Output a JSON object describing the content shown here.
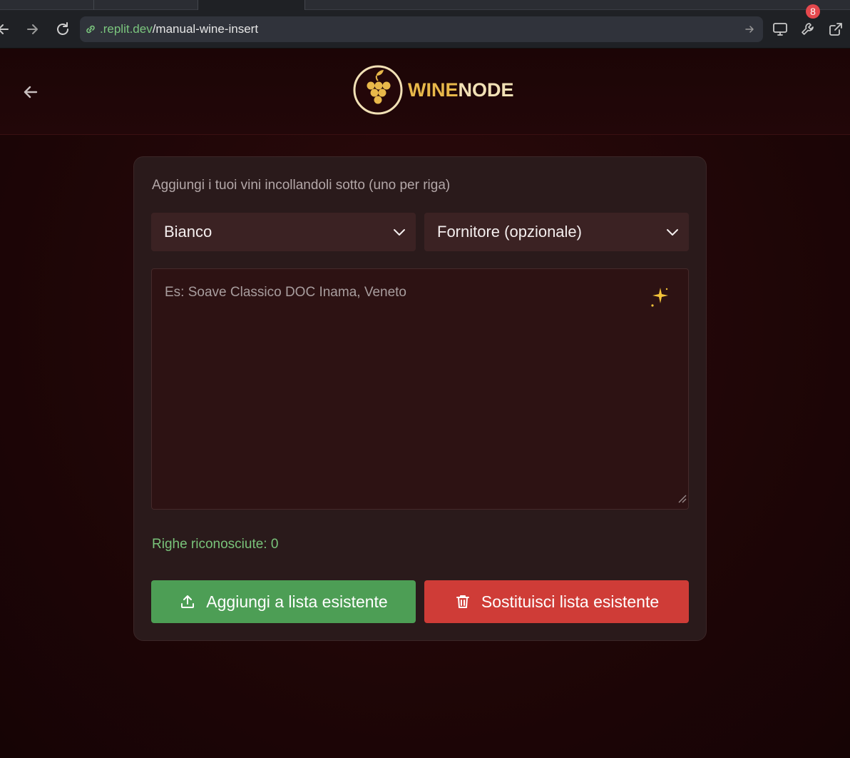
{
  "browser": {
    "url_host": ".replit.dev",
    "url_path": "/manual-wine-insert",
    "extensions_badge": "8",
    "icons": [
      "back-icon",
      "forward-icon",
      "reload-icon",
      "link-icon",
      "go-arrow-icon",
      "screen-icon",
      "wrench-icon",
      "external-link-icon"
    ]
  },
  "header": {
    "logo_wine": "WINE",
    "logo_node": "NODE",
    "back_icon": "arrow-left-icon"
  },
  "form": {
    "instruction": "Aggiungi i tuoi vini incollandoli sotto (uno per riga)",
    "type_select": "Bianco",
    "supplier_select": "Fornitore (opzionale)",
    "textarea_placeholder": "Es: Soave Classico DOC Inama, Veneto",
    "recognized_rows": "Righe riconosciute: 0",
    "add_button": "Aggiungi a lista esistente",
    "replace_button": "Sostituisci lista esistente"
  },
  "colors": {
    "accent_green": "#4d9e55",
    "accent_red": "#cf3c37",
    "logo_gold": "#e8b84a",
    "background": "#1c0506"
  }
}
